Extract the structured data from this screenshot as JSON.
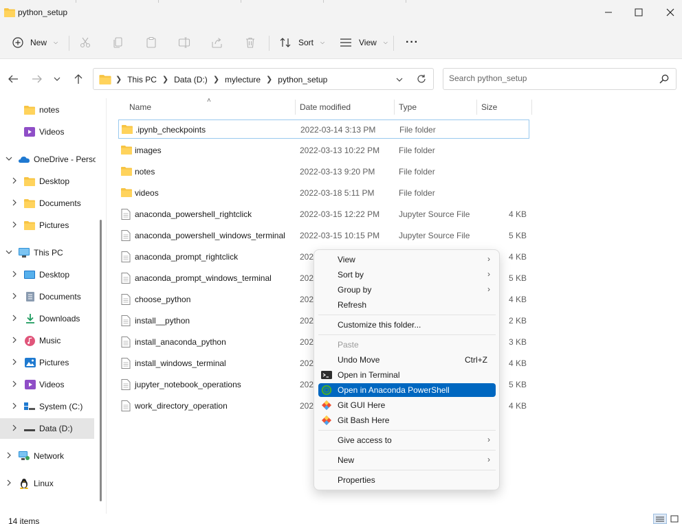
{
  "window": {
    "title": "python_setup"
  },
  "toolbar": {
    "new_label": "New",
    "sort_label": "Sort",
    "view_label": "View",
    "more_label": "···"
  },
  "address": {
    "crumbs": [
      "This PC",
      "Data (D:)",
      "mylecture",
      "python_setup"
    ],
    "search_placeholder": "Search python_setup"
  },
  "sidebar": {
    "items": [
      {
        "label": "notes",
        "icon": "folder-icon"
      },
      {
        "label": "Videos",
        "icon": "videos-icon"
      },
      {
        "label": "OneDrive - Perso",
        "icon": "onedrive-icon"
      },
      {
        "label": "Desktop",
        "icon": "folder-icon"
      },
      {
        "label": "Documents",
        "icon": "folder-icon"
      },
      {
        "label": "Pictures",
        "icon": "folder-icon"
      },
      {
        "label": "This PC",
        "icon": "computer-icon"
      },
      {
        "label": "Desktop",
        "icon": "desktop-icon"
      },
      {
        "label": "Documents",
        "icon": "documents-icon"
      },
      {
        "label": "Downloads",
        "icon": "download-icon"
      },
      {
        "label": "Music",
        "icon": "music-icon"
      },
      {
        "label": "Pictures",
        "icon": "pictures-icon"
      },
      {
        "label": "Videos",
        "icon": "videos-icon"
      },
      {
        "label": "System (C:)",
        "icon": "drive-icon"
      },
      {
        "label": "Data (D:)",
        "icon": "drive-icon"
      },
      {
        "label": "Network",
        "icon": "network-icon"
      },
      {
        "label": "Linux",
        "icon": "linux-icon"
      }
    ]
  },
  "columns": {
    "name": "Name",
    "date": "Date modified",
    "type": "Type",
    "size": "Size"
  },
  "files": [
    {
      "name": ".ipynb_checkpoints",
      "date": "2022-03-14 3:13 PM",
      "type": "File folder",
      "size": ""
    },
    {
      "name": "images",
      "date": "2022-03-13 10:22 PM",
      "type": "File folder",
      "size": ""
    },
    {
      "name": "notes",
      "date": "2022-03-13 9:20 PM",
      "type": "File folder",
      "size": ""
    },
    {
      "name": "videos",
      "date": "2022-03-18 5:11 PM",
      "type": "File folder",
      "size": ""
    },
    {
      "name": "anaconda_powershell_rightclick",
      "date": "2022-03-15 12:22 PM",
      "type": "Jupyter Source File",
      "size": "4 KB"
    },
    {
      "name": "anaconda_powershell_windows_terminal",
      "date": "2022-03-15 10:15 PM",
      "type": "Jupyter Source File",
      "size": "5 KB"
    },
    {
      "name": "anaconda_prompt_rightclick",
      "date": "202",
      "type": "",
      "size": "4 KB"
    },
    {
      "name": "anaconda_prompt_windows_terminal",
      "date": "202",
      "type": "",
      "size": "5 KB"
    },
    {
      "name": "choose_python",
      "date": "202",
      "type": "",
      "size": "4 KB"
    },
    {
      "name": "install__python",
      "date": "202",
      "type": "",
      "size": "2 KB"
    },
    {
      "name": "install_anaconda_python",
      "date": "202",
      "type": "",
      "size": "3 KB"
    },
    {
      "name": "install_windows_terminal",
      "date": "202",
      "type": "",
      "size": "4 KB"
    },
    {
      "name": "jupyter_notebook_operations",
      "date": "202",
      "type": "",
      "size": "5 KB"
    },
    {
      "name": "work_directory_operation",
      "date": "202",
      "type": "",
      "size": "4 KB"
    }
  ],
  "context_menu": {
    "view": "View",
    "sort_by": "Sort by",
    "group_by": "Group by",
    "refresh": "Refresh",
    "customize": "Customize this folder...",
    "paste": "Paste",
    "undo_move": "Undo Move",
    "undo_shortcut": "Ctrl+Z",
    "open_terminal": "Open in Terminal",
    "open_anaconda": "Open in Anaconda PowerShell",
    "git_gui": "Git GUI Here",
    "git_bash": "Git Bash Here",
    "give_access": "Give access to",
    "new": "New",
    "properties": "Properties"
  },
  "status": {
    "item_count": "14 items"
  },
  "colors": {
    "accent": "#0067c0",
    "folder": "#f7c443"
  }
}
